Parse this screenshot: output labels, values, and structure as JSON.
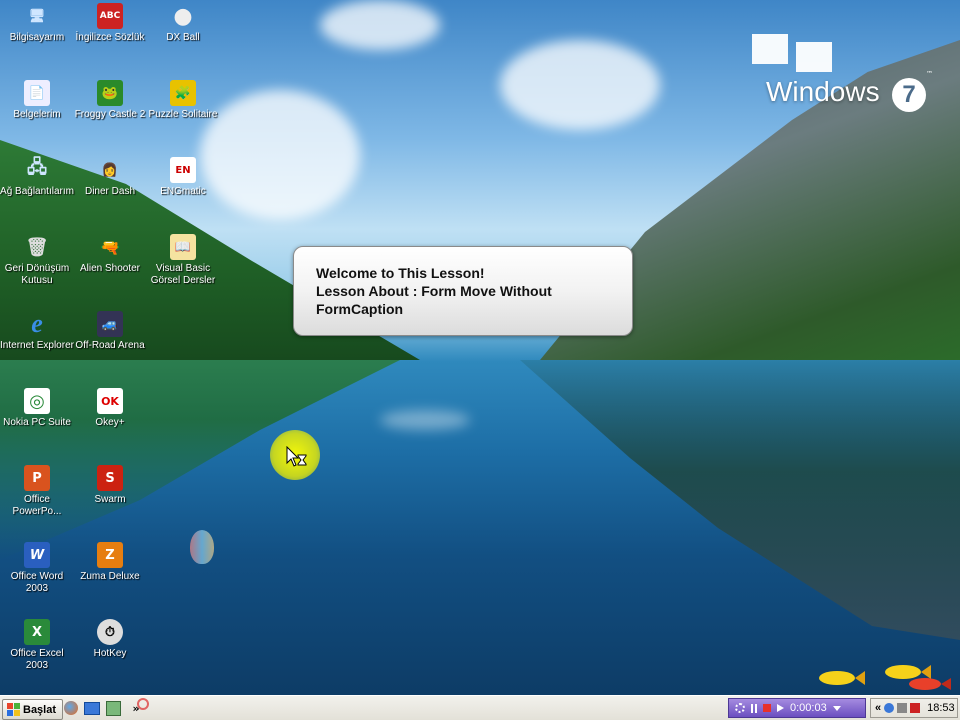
{
  "desktop": {
    "brand": {
      "word": "Windows",
      "badge": "7",
      "tm": "™"
    },
    "icons": [
      {
        "label": "Bilgisayarım",
        "glyph": "🖥"
      },
      {
        "label": "İngilizce Sözlük",
        "glyph": "ABC"
      },
      {
        "label": "DX Ball",
        "glyph": "●"
      },
      {
        "label": "Belgelerim",
        "glyph": "📄"
      },
      {
        "label": "Froggy Castle 2",
        "glyph": "🐸"
      },
      {
        "label": "Puzzle Solitaire",
        "glyph": "🧩"
      },
      {
        "label": "Ağ Bağlantılarım",
        "glyph": "🖧"
      },
      {
        "label": "Diner Dash",
        "glyph": "👩"
      },
      {
        "label": "ENGmatic",
        "glyph": "EN"
      },
      {
        "label": "Geri Dönüşüm Kutusu",
        "glyph": "🗑"
      },
      {
        "label": "Alien Shooter",
        "glyph": "🔫"
      },
      {
        "label": "Visual Basic Görsel Dersler",
        "glyph": "📖"
      },
      {
        "label": "Internet Explorer",
        "glyph": "e"
      },
      {
        "label": "Off-Road Arena",
        "glyph": "🚙"
      },
      {
        "label": "Nokia PC Suite",
        "glyph": "◎"
      },
      {
        "label": "Okey+",
        "glyph": "OK"
      },
      {
        "label": "Office PowerPo...",
        "glyph": "P"
      },
      {
        "label": "Swarm",
        "glyph": "S"
      },
      {
        "label": "Office Word 2003",
        "glyph": "W"
      },
      {
        "label": "Zuma Deluxe",
        "glyph": "Z"
      },
      {
        "label": "Office Excel 2003",
        "glyph": "X"
      },
      {
        "label": "HotKey",
        "glyph": "⏱"
      }
    ]
  },
  "lesson": {
    "line1": "Welcome to This Lesson!",
    "line2": "Lesson About : Form Move Without",
    "line3": "FormCaption"
  },
  "taskbar": {
    "start_label": "Başlat",
    "quick_launch_more": "»",
    "recorder_time": "0:00:03",
    "tray_more": "«",
    "clock": "18:53"
  },
  "colors": {
    "taskbar": "#ece9d8",
    "recorder": "#7a5cc8",
    "cursor_highlight": "#f0f000"
  }
}
